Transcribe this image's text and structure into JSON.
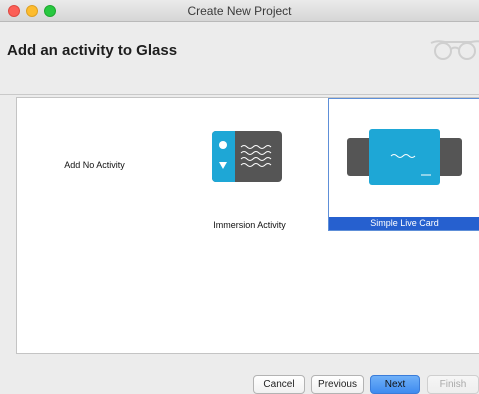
{
  "window": {
    "title": "Create New Project"
  },
  "header": {
    "title": "Add an activity to Glass",
    "logo_icon": "glass-glasses-icon"
  },
  "gallery": {
    "items": [
      {
        "label": "Add No Activity",
        "selected": false
      },
      {
        "label": "Immersion Activity",
        "selected": false,
        "icon": "immersion-activity-icon"
      },
      {
        "label": "Simple Live Card",
        "selected": true,
        "icon": "simple-live-card-icon"
      }
    ]
  },
  "buttons": {
    "cancel": "Cancel",
    "previous": "Previous",
    "next": "Next",
    "finish": "Finish"
  },
  "colors": {
    "accent": "#2660cf",
    "glass_blue": "#1ea7d6",
    "dark_gray": "#555555"
  }
}
